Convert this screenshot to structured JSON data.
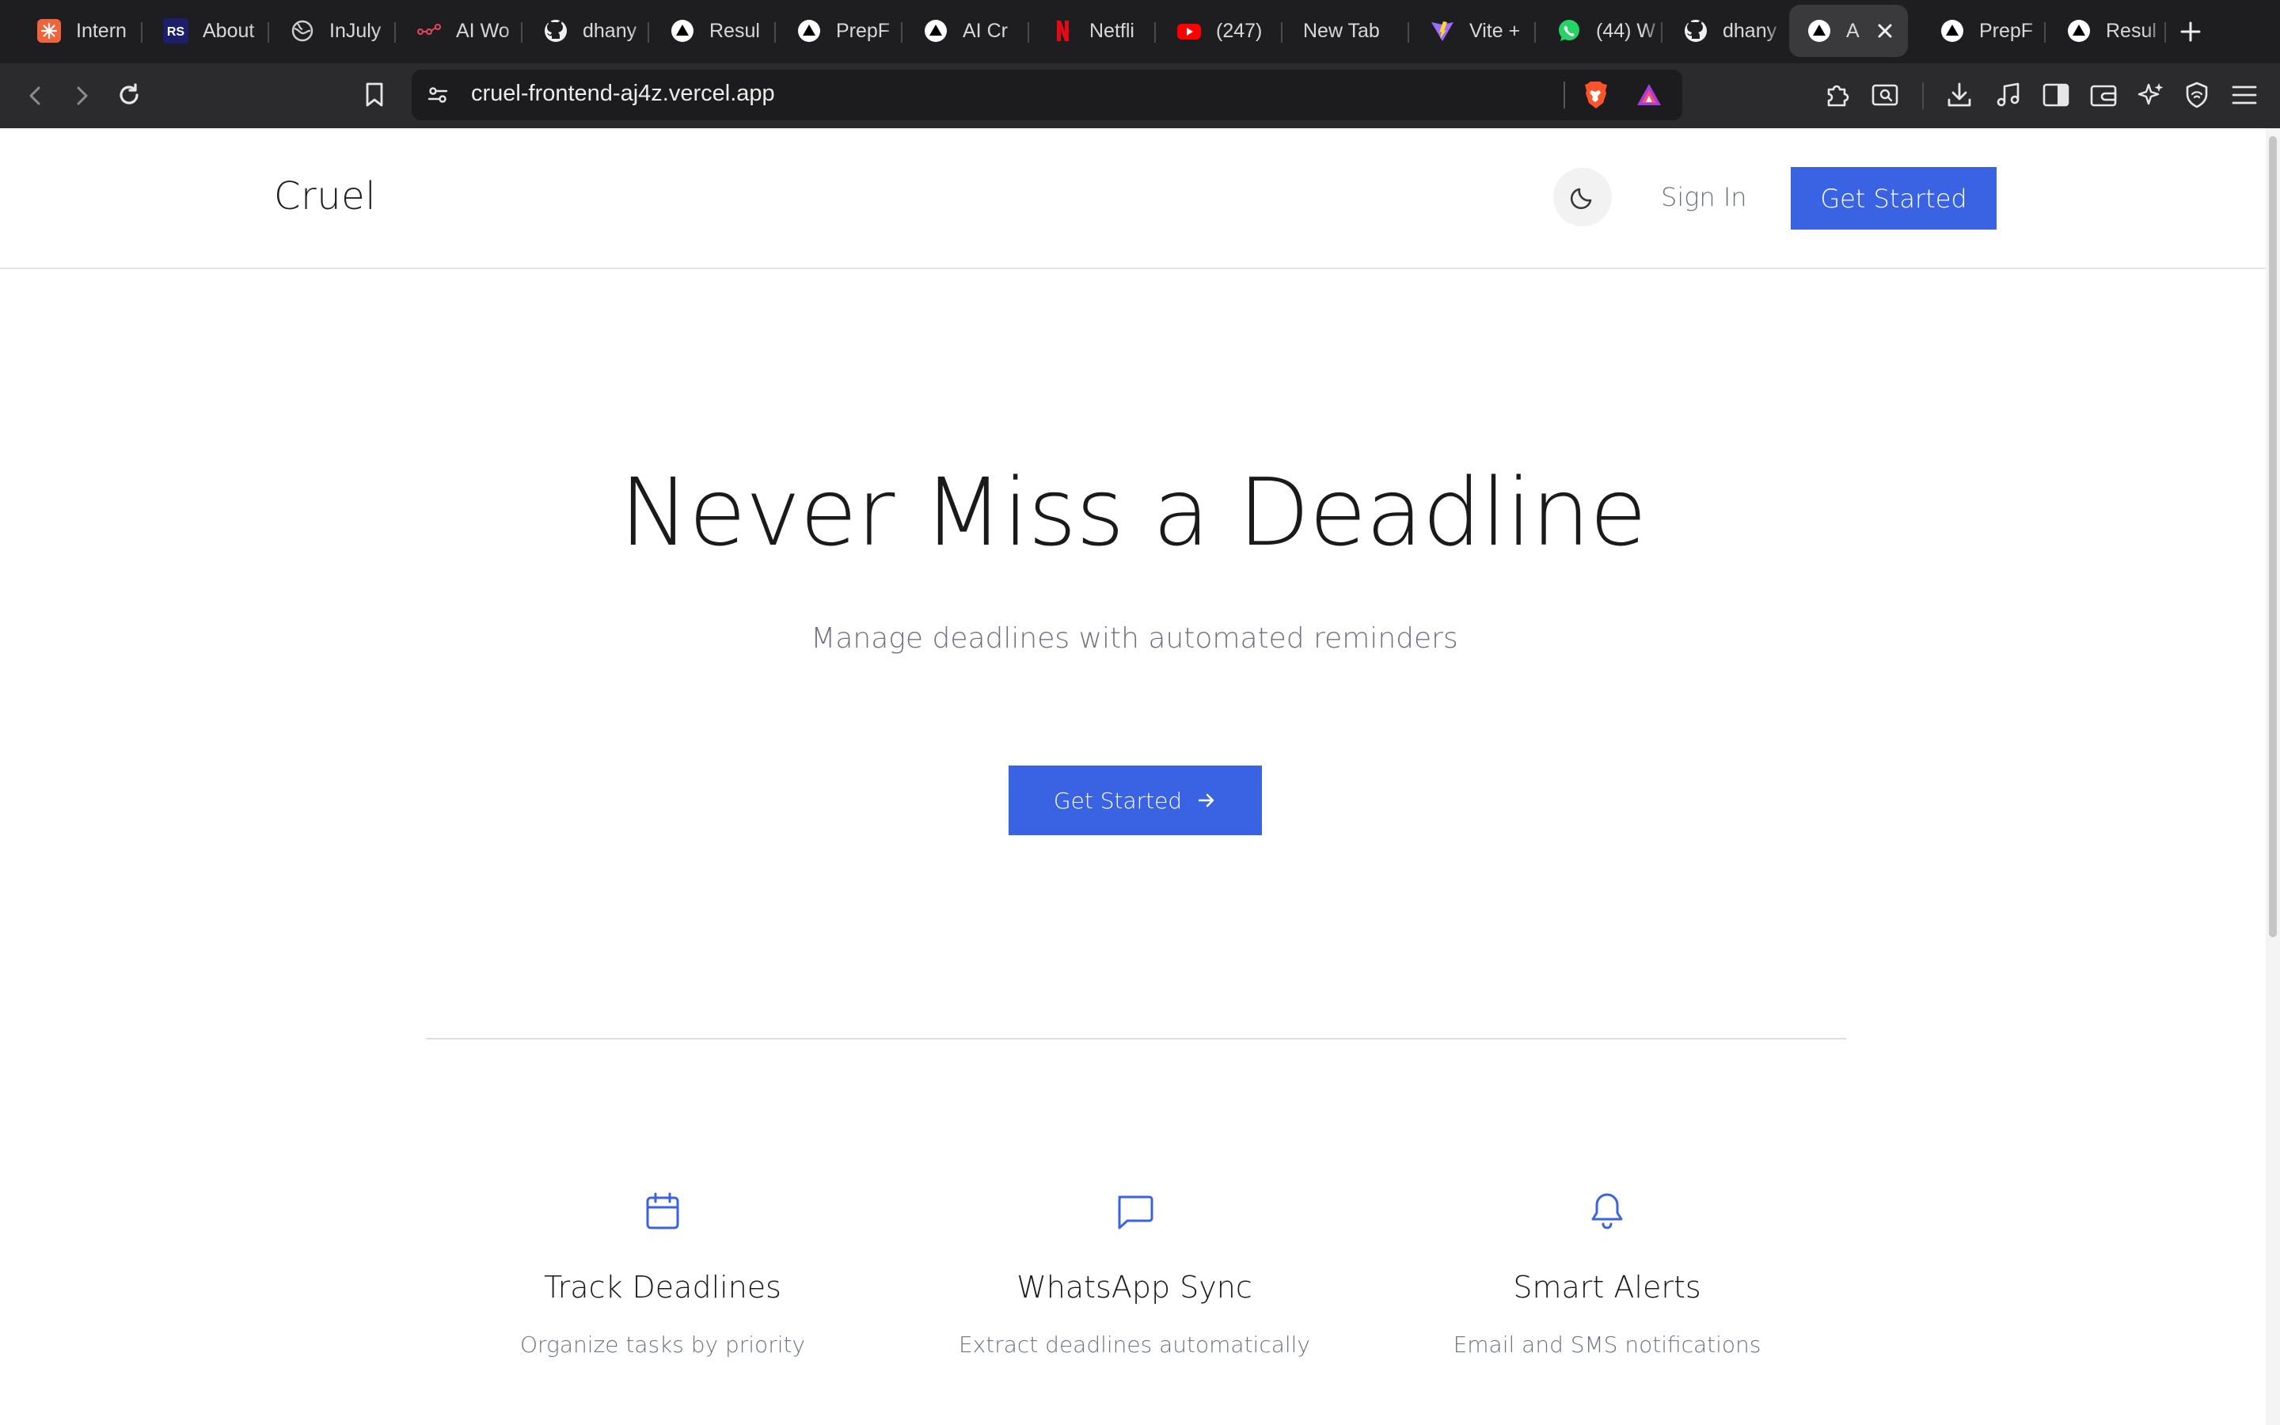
{
  "browser": {
    "tabs": [
      {
        "label": "Intern",
        "icon": "sparkle-orange-icon",
        "active": false
      },
      {
        "label": "About",
        "icon": "rs-logo-icon",
        "active": false
      },
      {
        "label": "InJuly",
        "icon": "globe-icon",
        "active": false
      },
      {
        "label": "AI Wo",
        "icon": "workflow-icon",
        "active": false
      },
      {
        "label": "dhany",
        "icon": "github-icon",
        "active": false
      },
      {
        "label": "Resul",
        "icon": "vercel-icon",
        "active": false
      },
      {
        "label": "PrepF",
        "icon": "vercel-icon",
        "active": false
      },
      {
        "label": "AI Cr",
        "icon": "vercel-icon",
        "active": false
      },
      {
        "label": "Netfli",
        "icon": "netflix-icon",
        "active": false
      },
      {
        "label": "(247)",
        "icon": "youtube-icon",
        "active": false
      },
      {
        "label": "New Tab",
        "icon": "",
        "active": false
      },
      {
        "label": "Vite +",
        "icon": "vite-icon",
        "active": false
      },
      {
        "label": "(44) W",
        "icon": "whatsapp-icon",
        "active": false
      },
      {
        "label": "dhany",
        "icon": "github-icon",
        "active": false
      },
      {
        "label": "A",
        "icon": "vercel-icon",
        "active": true
      },
      {
        "label": "PrepF",
        "icon": "vercel-icon",
        "active": false
      },
      {
        "label": "Resul",
        "icon": "vercel-icon",
        "active": false
      }
    ],
    "url": "cruel-frontend-aj4z.vercel.app"
  },
  "nav": {
    "brand": "Cruel",
    "sign_in": "Sign In",
    "get_started": "Get Started"
  },
  "hero": {
    "title": "Never Miss a Deadline",
    "subtitle": "Manage deadlines with automated reminders",
    "cta": "Get Started"
  },
  "features": [
    {
      "icon": "calendar-icon",
      "title": "Track Deadlines",
      "description": "Organize tasks by priority"
    },
    {
      "icon": "message-icon",
      "title": "WhatsApp Sync",
      "description": "Extract deadlines automatically"
    },
    {
      "icon": "bell-icon",
      "title": "Smart Alerts",
      "description": "Email and SMS notifications"
    }
  ],
  "colors": {
    "accent": "#3a63e4",
    "text": "#1a1a1a",
    "muted": "#6b7280"
  }
}
